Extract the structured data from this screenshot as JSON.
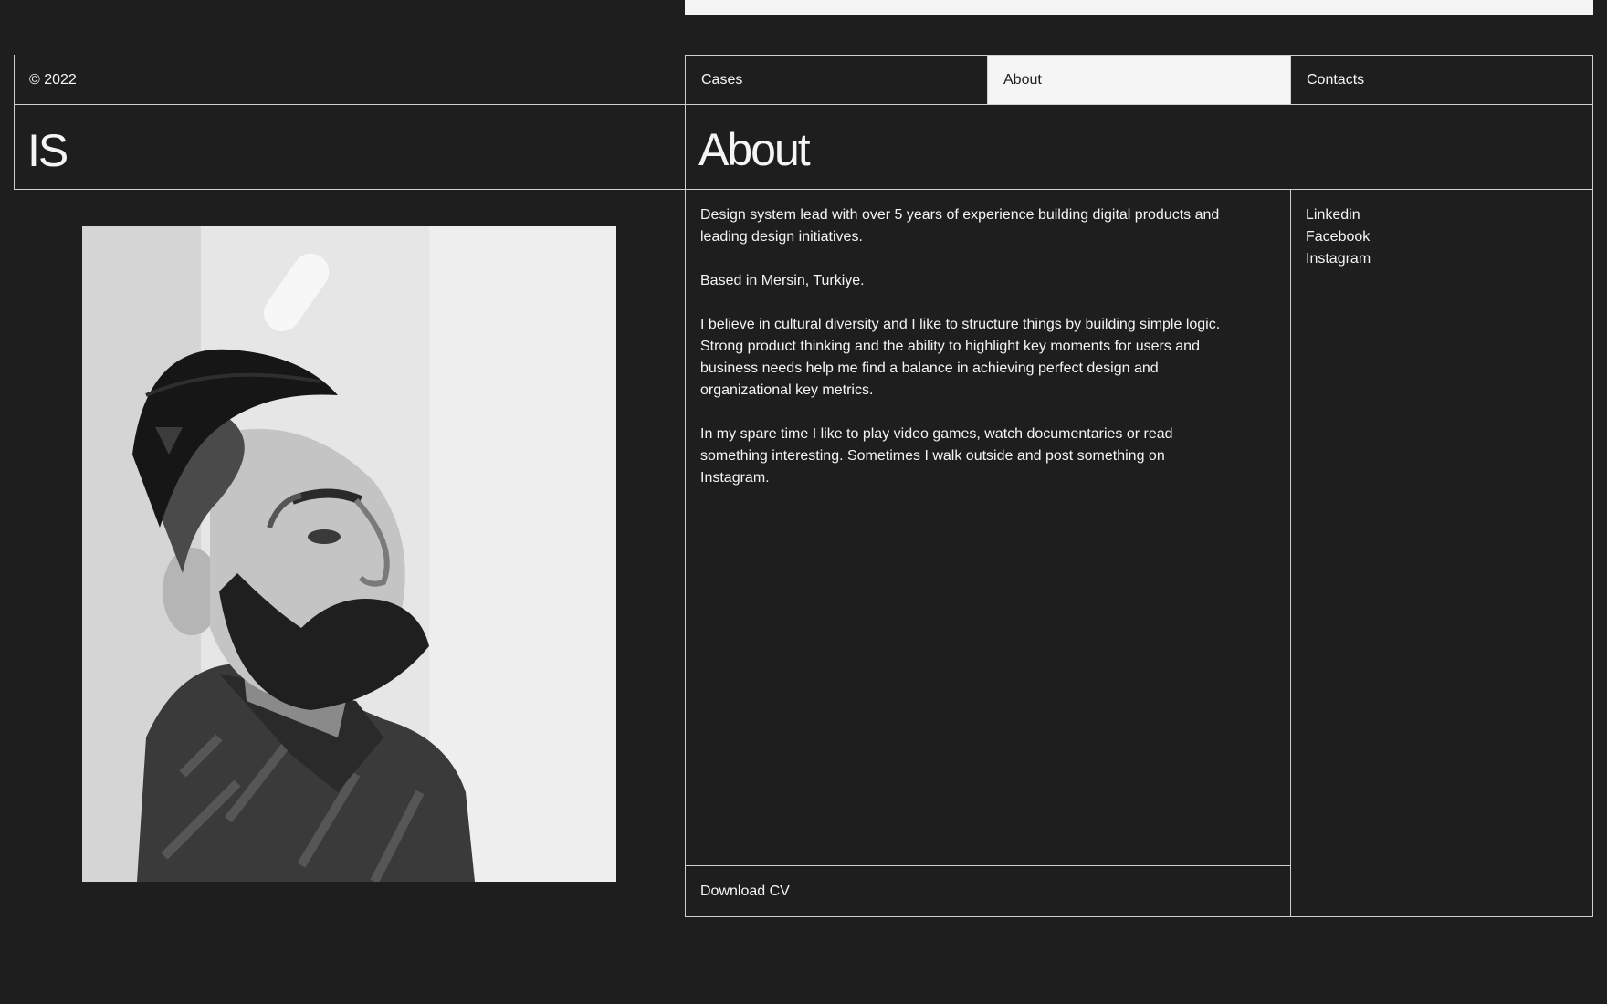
{
  "footer": {
    "copyright": "© 2022"
  },
  "brand": {
    "logo": "IS"
  },
  "nav": {
    "items": [
      {
        "label": "Cases",
        "active": false
      },
      {
        "label": "About",
        "active": true
      },
      {
        "label": "Contacts",
        "active": false
      }
    ]
  },
  "page": {
    "title": "About"
  },
  "bio": {
    "paragraphs": [
      "Design system lead with over 5 years of experience building digital products and leading design initiatives.",
      "Based in Mersin, Turkiye.",
      "I believe in cultural diversity and I like to structure things by building simple logic. Strong product thinking and the ability to highlight key moments for users and business needs help me find a balance in achieving perfect design and organizational key metrics.",
      "In my spare time I like to play video games, watch documentaries or read something interesting. Sometimes I walk outside and post something on Instagram."
    ]
  },
  "social": {
    "links": [
      {
        "label": "Linkedin"
      },
      {
        "label": "Facebook"
      },
      {
        "label": "Instagram"
      }
    ]
  },
  "cv": {
    "label": "Download CV"
  },
  "colors": {
    "background": "#1e1e1e",
    "foreground": "#f5f5f5",
    "lines": "#cfcfcf",
    "active_tab_bg": "#f5f5f5",
    "active_tab_text": "#1e1e1e"
  }
}
